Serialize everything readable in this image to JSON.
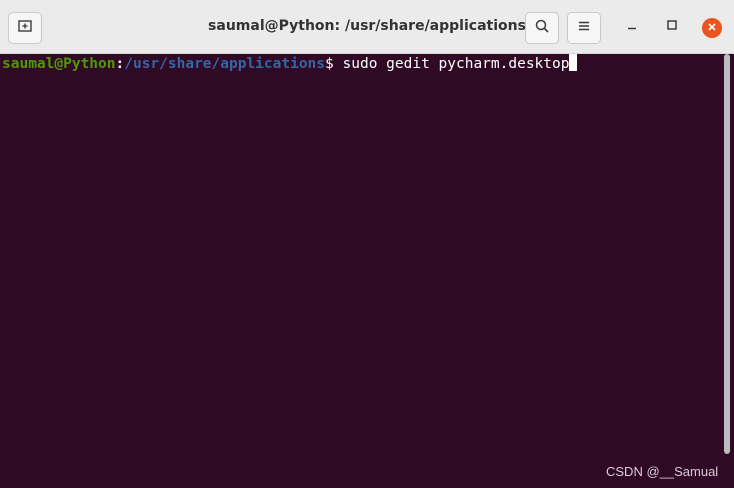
{
  "window": {
    "title": "saumal@Python: /usr/share/applications"
  },
  "titlebar": {
    "new_tab_icon": "new-tab-icon",
    "search_icon": "search-icon",
    "menu_icon": "hamburger-menu-icon",
    "minimize_icon": "minimize-icon",
    "maximize_icon": "maximize-icon",
    "close_icon": "close-icon"
  },
  "terminal": {
    "prompt_user": "saumal@Python",
    "prompt_colon": ":",
    "prompt_path": "/usr/share/applications",
    "prompt_symbol": "$ ",
    "command": "sudo gedit pycharm.desktop"
  },
  "watermark": "CSDN @__Samual",
  "colors": {
    "terminal_background": "#300a24",
    "prompt_user": "#4e9a06",
    "prompt_path": "#3465a4",
    "close_button": "#e95420"
  }
}
